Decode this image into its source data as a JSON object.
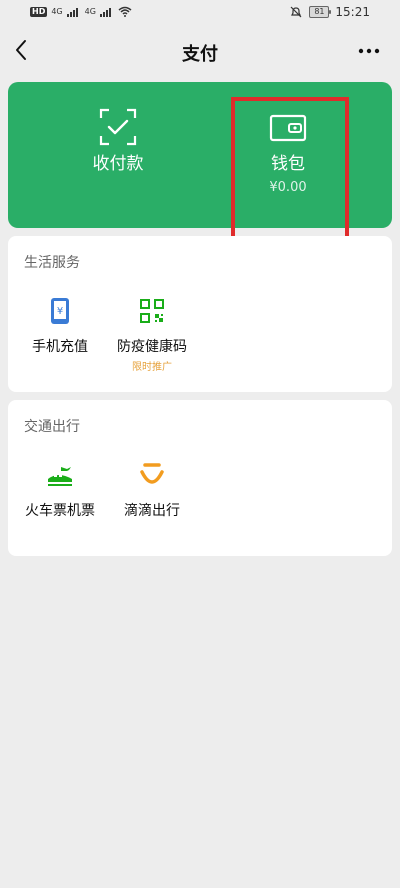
{
  "status_bar": {
    "hd": "HD",
    "net1": "4G",
    "net2": "4G",
    "battery": "81",
    "time": "15:21"
  },
  "nav": {
    "title": "支付"
  },
  "pay_card": {
    "left": {
      "label": "收付款"
    },
    "right": {
      "label": "钱包",
      "balance": "¥0.00"
    }
  },
  "sections": [
    {
      "title": "生活服务",
      "items": [
        {
          "label": "手机充值",
          "icon": "phone-recharge-icon"
        },
        {
          "label": "防疫健康码",
          "badge": "限时推广",
          "icon": "qr-code-icon"
        }
      ]
    },
    {
      "title": "交通出行",
      "items": [
        {
          "label": "火车票机票",
          "icon": "train-plane-icon"
        },
        {
          "label": "滴滴出行",
          "icon": "didi-icon"
        }
      ]
    }
  ],
  "colors": {
    "brand_green": "#2aae67",
    "highlight_red": "#e02b2b",
    "badge_orange": "#e6a23c",
    "background": "#ededed"
  }
}
